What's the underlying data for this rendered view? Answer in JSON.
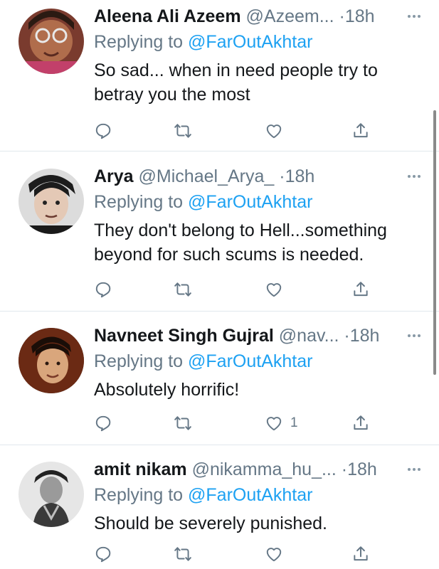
{
  "colors": {
    "link": "#1da1f2",
    "secondary": "#657786",
    "divider": "#e1e8ed"
  },
  "reply_prefix": "Replying to",
  "tweets": [
    {
      "name": "Aleena Ali Azeem",
      "handle": "@Azeem...",
      "time": "18h",
      "mention": "@FarOutAkhtar",
      "text": "So sad... when in need people try to betray you the most",
      "likes": "",
      "icons": [
        "reply-icon",
        "retweet-icon",
        "like-icon",
        "share-icon"
      ]
    },
    {
      "name": "Arya",
      "handle": "@Michael_Arya_",
      "time": "18h",
      "mention": "@FarOutAkhtar",
      "text": "They don't belong to Hell...something beyond for such scums is needed.",
      "likes": "",
      "icons": [
        "reply-icon",
        "retweet-icon",
        "like-icon",
        "share-icon"
      ]
    },
    {
      "name": "Navneet Singh Gujral",
      "handle": "@nav...",
      "time": "18h",
      "mention": "@FarOutAkhtar",
      "text": "Absolutely horrific!",
      "likes": "1",
      "icons": [
        "reply-icon",
        "retweet-icon",
        "like-icon",
        "share-icon"
      ]
    },
    {
      "name": "amit nikam",
      "handle": "@nikamma_hu_...",
      "time": "18h",
      "mention": "@FarOutAkhtar",
      "text": "Should be severely punished.",
      "likes": "",
      "icons": [
        "reply-icon",
        "retweet-icon",
        "like-icon",
        "share-icon"
      ]
    }
  ]
}
